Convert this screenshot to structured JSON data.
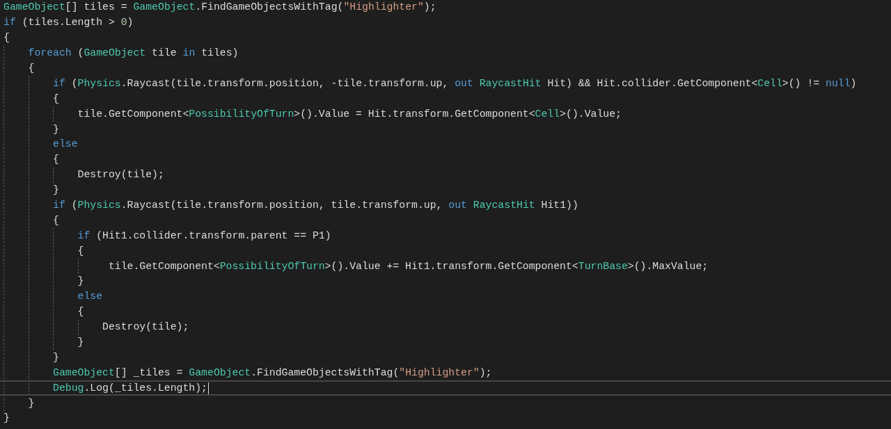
{
  "lines": [
    {
      "tokens": [
        {
          "kind": "type",
          "text": "GameObject"
        },
        {
          "kind": "plain",
          "text": "[] tiles = "
        },
        {
          "kind": "type",
          "text": "GameObject"
        },
        {
          "kind": "plain",
          "text": ".FindGameObjectsWithTag("
        },
        {
          "kind": "string",
          "text": "\"Highlighter\""
        },
        {
          "kind": "plain",
          "text": ");"
        }
      ]
    },
    {
      "tokens": [
        {
          "kind": "keyword",
          "text": "if"
        },
        {
          "kind": "plain",
          "text": " (tiles.Length > "
        },
        {
          "kind": "number",
          "text": "0"
        },
        {
          "kind": "plain",
          "text": ")"
        }
      ]
    },
    {
      "tokens": [
        {
          "kind": "plain",
          "text": "{"
        }
      ],
      "children": [
        {
          "tokens": [
            {
              "kind": "keyword",
              "text": "foreach"
            },
            {
              "kind": "plain",
              "text": " ("
            },
            {
              "kind": "type",
              "text": "GameObject"
            },
            {
              "kind": "plain",
              "text": " tile "
            },
            {
              "kind": "keyword",
              "text": "in"
            },
            {
              "kind": "plain",
              "text": " tiles)"
            }
          ]
        },
        {
          "tokens": [
            {
              "kind": "plain",
              "text": "{"
            }
          ],
          "children": [
            {
              "tokens": [
                {
                  "kind": "keyword",
                  "text": "if"
                },
                {
                  "kind": "plain",
                  "text": " ("
                },
                {
                  "kind": "type",
                  "text": "Physics"
                },
                {
                  "kind": "plain",
                  "text": ".Raycast(tile.transform.position, -tile.transform.up, "
                },
                {
                  "kind": "keyword",
                  "text": "out"
                },
                {
                  "kind": "type",
                  "text": " RaycastHit"
                },
                {
                  "kind": "plain",
                  "text": " Hit) && Hit.collider.GetComponent<"
                },
                {
                  "kind": "type",
                  "text": "Cell"
                },
                {
                  "kind": "plain",
                  "text": ">() != "
                },
                {
                  "kind": "keyword",
                  "text": "null"
                },
                {
                  "kind": "plain",
                  "text": ")"
                }
              ]
            },
            {
              "tokens": [
                {
                  "kind": "plain",
                  "text": "{"
                }
              ],
              "children": [
                {
                  "tokens": [
                    {
                      "kind": "plain",
                      "text": "tile.GetComponent<"
                    },
                    {
                      "kind": "type",
                      "text": "PossibilityOfTurn"
                    },
                    {
                      "kind": "plain",
                      "text": ">().Value = Hit.transform.GetComponent<"
                    },
                    {
                      "kind": "type",
                      "text": "Cell"
                    },
                    {
                      "kind": "plain",
                      "text": ">().Value;"
                    }
                  ]
                }
              ]
            },
            {
              "tokens": [
                {
                  "kind": "plain",
                  "text": "}"
                }
              ]
            },
            {
              "tokens": [
                {
                  "kind": "keyword",
                  "text": "else"
                }
              ]
            },
            {
              "tokens": [
                {
                  "kind": "plain",
                  "text": "{"
                }
              ],
              "children": [
                {
                  "tokens": [
                    {
                      "kind": "plain",
                      "text": "Destroy(tile);"
                    }
                  ]
                }
              ]
            },
            {
              "tokens": [
                {
                  "kind": "plain",
                  "text": "}"
                }
              ]
            },
            {
              "tokens": [
                {
                  "kind": "keyword",
                  "text": "if"
                },
                {
                  "kind": "plain",
                  "text": " ("
                },
                {
                  "kind": "type",
                  "text": "Physics"
                },
                {
                  "kind": "plain",
                  "text": ".Raycast(tile.transform.position, tile.transform.up, "
                },
                {
                  "kind": "keyword",
                  "text": "out"
                },
                {
                  "kind": "type",
                  "text": " RaycastHit"
                },
                {
                  "kind": "plain",
                  "text": " Hit1))"
                }
              ]
            },
            {
              "tokens": [
                {
                  "kind": "plain",
                  "text": "{"
                }
              ],
              "children": [
                {
                  "tokens": [
                    {
                      "kind": "keyword",
                      "text": "if"
                    },
                    {
                      "kind": "plain",
                      "text": " (Hit1.collider.transform.parent == P1)"
                    }
                  ]
                },
                {
                  "tokens": [
                    {
                      "kind": "plain",
                      "text": "{"
                    }
                  ],
                  "children": [
                    {
                      "tokens": [
                        {
                          "kind": "plain",
                          "text": " tile.GetComponent<"
                        },
                        {
                          "kind": "type",
                          "text": "PossibilityOfTurn"
                        },
                        {
                          "kind": "plain",
                          "text": ">().Value += Hit1.transform.GetComponent<"
                        },
                        {
                          "kind": "type",
                          "text": "TurnBase"
                        },
                        {
                          "kind": "plain",
                          "text": ">().MaxValue;"
                        }
                      ]
                    }
                  ]
                },
                {
                  "tokens": [
                    {
                      "kind": "plain",
                      "text": "}"
                    }
                  ]
                },
                {
                  "tokens": [
                    {
                      "kind": "keyword",
                      "text": "else"
                    }
                  ]
                },
                {
                  "tokens": [
                    {
                      "kind": "plain",
                      "text": "{"
                    }
                  ],
                  "children": [
                    {
                      "tokens": [
                        {
                          "kind": "plain",
                          "text": "Destroy(tile);"
                        }
                      ]
                    }
                  ]
                },
                {
                  "tokens": [
                    {
                      "kind": "plain",
                      "text": "}"
                    }
                  ]
                }
              ]
            },
            {
              "tokens": [
                {
                  "kind": "plain",
                  "text": "}"
                }
              ]
            },
            {
              "tokens": [
                {
                  "kind": "type",
                  "text": "GameObject"
                },
                {
                  "kind": "plain",
                  "text": "[] _tiles = "
                },
                {
                  "kind": "type",
                  "text": "GameObject"
                },
                {
                  "kind": "plain",
                  "text": ".FindGameObjectsWithTag("
                },
                {
                  "kind": "string",
                  "text": "\"Highlighter\""
                },
                {
                  "kind": "plain",
                  "text": ");"
                }
              ]
            },
            {
              "tokens": [
                {
                  "kind": "type",
                  "text": "Debug"
                },
                {
                  "kind": "plain",
                  "text": ".Log(_tiles.Length);"
                }
              ],
              "current": true
            }
          ]
        },
        {
          "tokens": [
            {
              "kind": "plain",
              "text": "}"
            }
          ]
        }
      ]
    },
    {
      "tokens": [
        {
          "kind": "plain",
          "text": "}"
        }
      ]
    }
  ]
}
